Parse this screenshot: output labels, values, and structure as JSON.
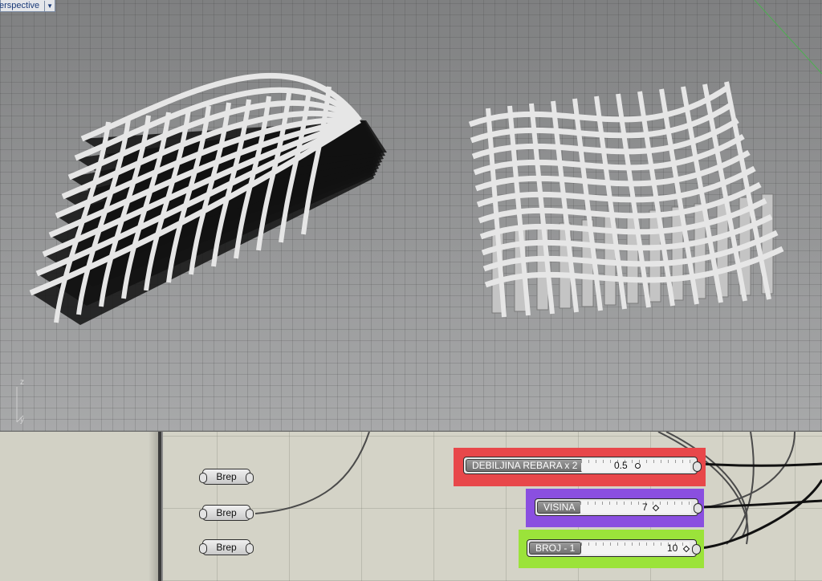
{
  "viewport": {
    "tab_label": "erspective",
    "axis_z": "z",
    "axis_y": "y"
  },
  "grasshopper": {
    "brep_components": [
      {
        "label": "Brep"
      },
      {
        "label": "Brep"
      },
      {
        "label": "Brep"
      }
    ],
    "sliders": [
      {
        "name": "DEBILJINA REBARA x 2",
        "value": "0.5",
        "group_color": "#e8474a"
      },
      {
        "name": "VISINA",
        "value": "7",
        "group_color": "#8a4fe0"
      },
      {
        "name": "BROJ - 1",
        "value": "10",
        "group_color": "#9be33a"
      }
    ]
  },
  "colors": {
    "viewport_bg": "#8c8d8e",
    "gh_canvas_bg": "#d4d3c7",
    "fin_light": "#e6e6e6",
    "fin_dark": "#121212"
  }
}
